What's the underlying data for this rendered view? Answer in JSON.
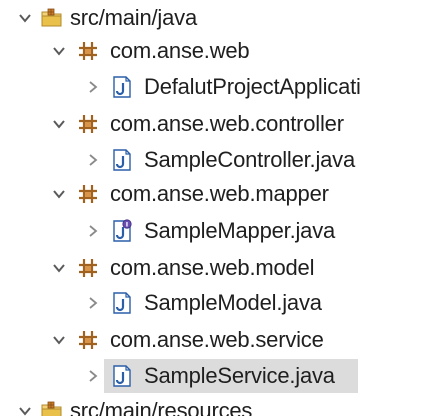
{
  "tree": {
    "source_folder": {
      "label": "src/main/java",
      "icon": "source-folder-icon"
    },
    "packages": [
      {
        "label": "com.anse.web",
        "icon": "package-icon",
        "file": {
          "label": "DefalutProjectApplicati",
          "icon": "java-class-icon"
        }
      },
      {
        "label": "com.anse.web.controller",
        "icon": "package-icon",
        "file": {
          "label": "SampleController.java",
          "icon": "java-class-icon"
        }
      },
      {
        "label": "com.anse.web.mapper",
        "icon": "package-icon",
        "file": {
          "label": "SampleMapper.java",
          "icon": "java-interface-icon"
        }
      },
      {
        "label": "com.anse.web.model",
        "icon": "package-icon",
        "file": {
          "label": "SampleModel.java",
          "icon": "java-class-icon"
        }
      },
      {
        "label": "com.anse.web.service",
        "icon": "package-icon",
        "file": {
          "label": "SampleService.java",
          "icon": "java-class-icon",
          "selected": true
        }
      }
    ],
    "next_source_folder": {
      "label": "src/main/resources",
      "icon": "source-folder-icon"
    }
  },
  "colors": {
    "text": "#1f1f1f",
    "twisty": "#5a5a5a",
    "package_brown": "#a0621e",
    "java_blue": "#2a5fa8",
    "folder_yellow": "#e8c04a",
    "selection": "#dcdcdc"
  }
}
